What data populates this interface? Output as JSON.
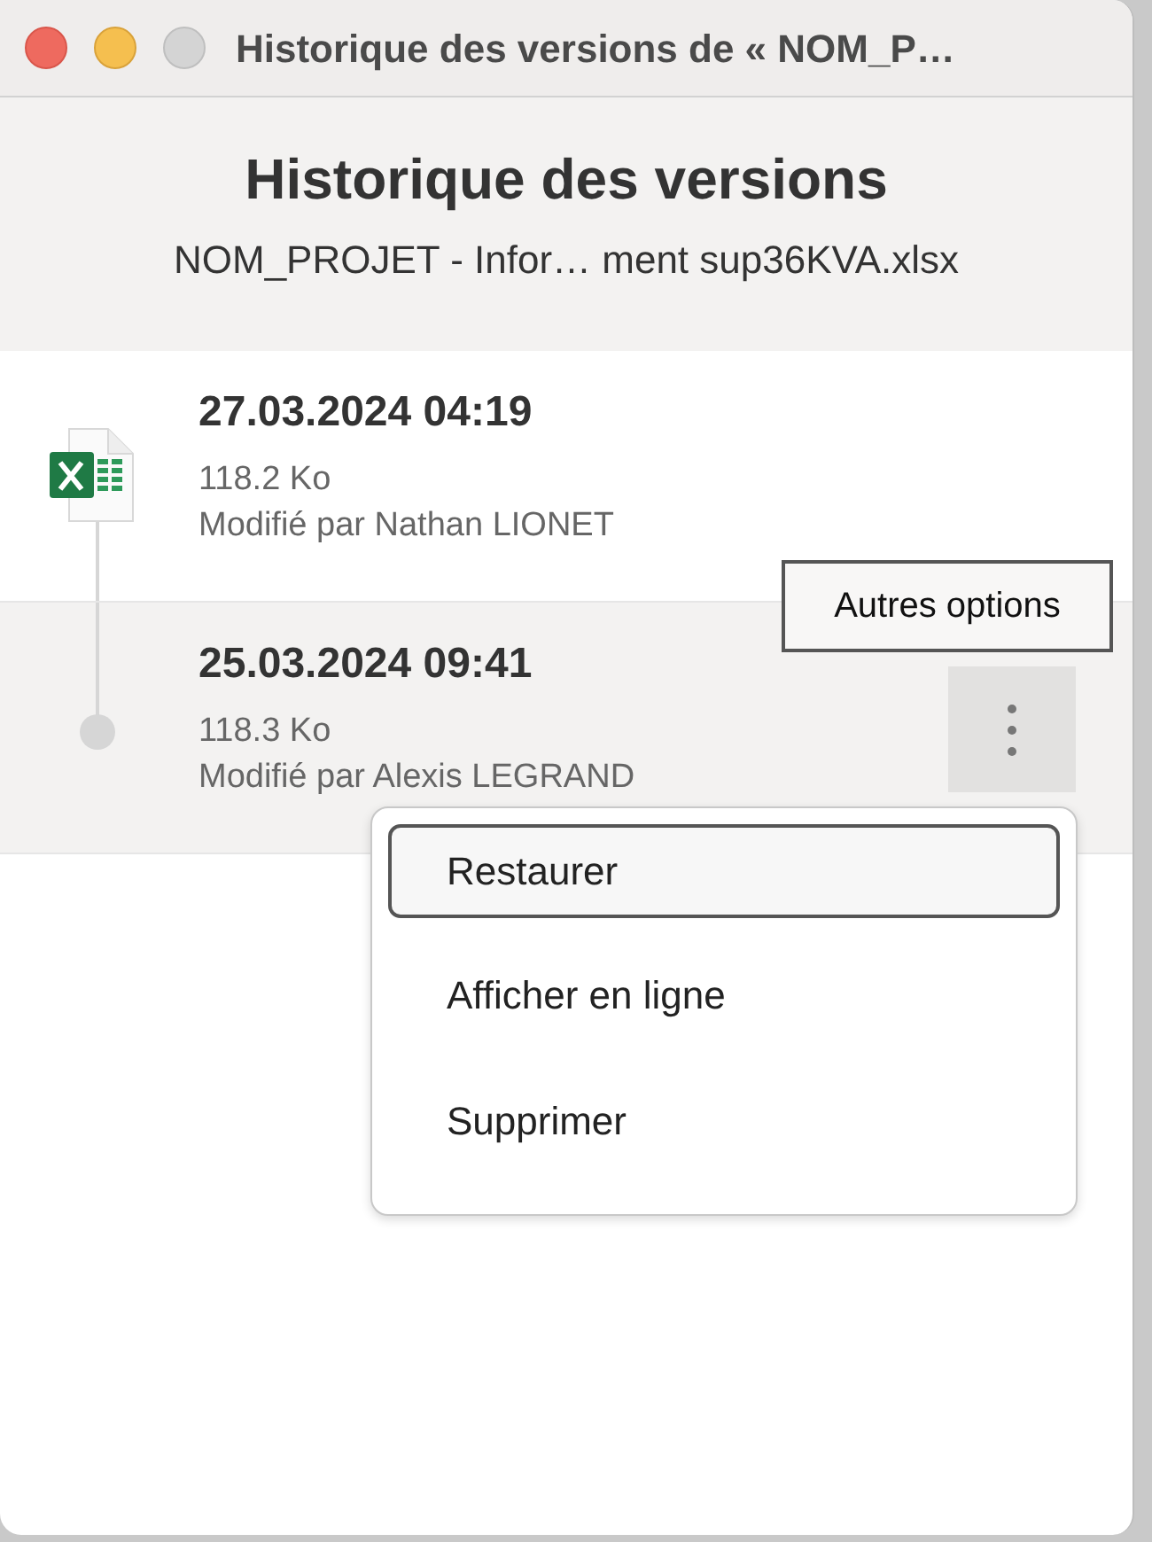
{
  "window": {
    "title": "Historique des versions de « NOM_P…"
  },
  "header": {
    "title": "Historique des versions",
    "file_name": "NOM_PROJET - Infor… ment sup36KVA.xlsx"
  },
  "versions": [
    {
      "kind": "current",
      "date": "27.03.2024 04:19",
      "size": "118.2 Ko",
      "modified_by": "Modifié par Nathan LIONET",
      "selected": false
    },
    {
      "kind": "previous",
      "date": "25.03.2024 09:41",
      "size": "118.3 Ko",
      "modified_by": "Modifié par Alexis LEGRAND",
      "selected": true
    }
  ],
  "tooltip": {
    "text": "Autres options"
  },
  "context_menu": {
    "items": [
      {
        "label": "Restaurer",
        "focused": true
      },
      {
        "label": "Afficher en ligne",
        "focused": false
      },
      {
        "label": "Supprimer",
        "focused": false
      }
    ]
  }
}
